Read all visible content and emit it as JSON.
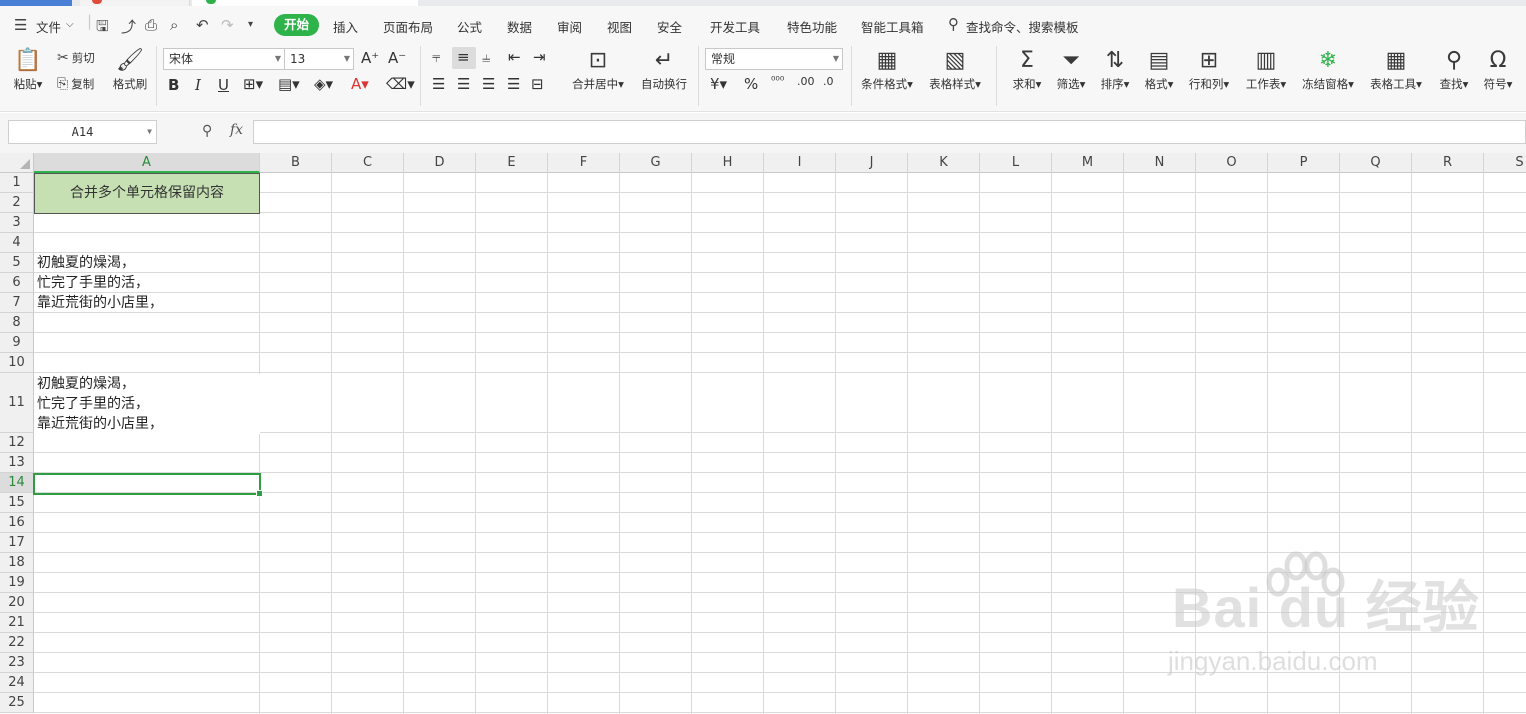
{
  "menu": {
    "file": "文件",
    "tabs": [
      "开始",
      "插入",
      "页面布局",
      "公式",
      "数据",
      "审阅",
      "视图",
      "安全",
      "开发工具",
      "特色功能",
      "智能工具箱"
    ],
    "active_tab": "开始",
    "search": "查找命令、搜索模板"
  },
  "ribbon": {
    "paste": "粘贴",
    "cut": "剪切",
    "copy": "复制",
    "format_painter": "格式刷",
    "font_name": "宋体",
    "font_size": "13",
    "merge_center": "合并居中",
    "wrap_text": "自动换行",
    "number_format": "常规",
    "cond_format": "条件格式",
    "table_style": "表格样式",
    "sum": "求和",
    "filter": "筛选",
    "sort": "排序",
    "format": "格式",
    "row_col": "行和列",
    "worksheet": "工作表",
    "freeze": "冻结窗格",
    "table_tools": "表格工具",
    "find": "查找",
    "symbol": "符号"
  },
  "formula_bar": {
    "name_box": "A14",
    "fx": "fx",
    "formula": ""
  },
  "sheet": {
    "columns": [
      "A",
      "B",
      "C",
      "D",
      "E",
      "F",
      "G",
      "H",
      "I",
      "J",
      "K",
      "L",
      "M",
      "N",
      "O",
      "P",
      "Q",
      "R",
      "S"
    ],
    "rows": [
      "1",
      "2",
      "3",
      "4",
      "5",
      "6",
      "7",
      "8",
      "9",
      "10",
      "11",
      "12",
      "13",
      "14",
      "15",
      "16",
      "17",
      "18",
      "19",
      "20",
      "21",
      "22",
      "23",
      "24",
      "25"
    ],
    "selected_column": "A",
    "selected_row": "14",
    "a1_merged": "合并多个单元格保留内容",
    "a5": "初触夏的燥渴，",
    "a6": "忙完了手里的活，",
    "a7": "靠近荒街的小店里，",
    "a11_line1": "初触夏的燥渴，",
    "a11_line2": "忙完了手里的活，",
    "a11_line3": "靠近荒街的小店里，"
  },
  "watermark": {
    "logo": "Bai du 经验",
    "url": "jingyan.baidu.com"
  },
  "colors": {
    "accent_green": "#2eb24a",
    "merged_fill": "#c6e0b4"
  }
}
